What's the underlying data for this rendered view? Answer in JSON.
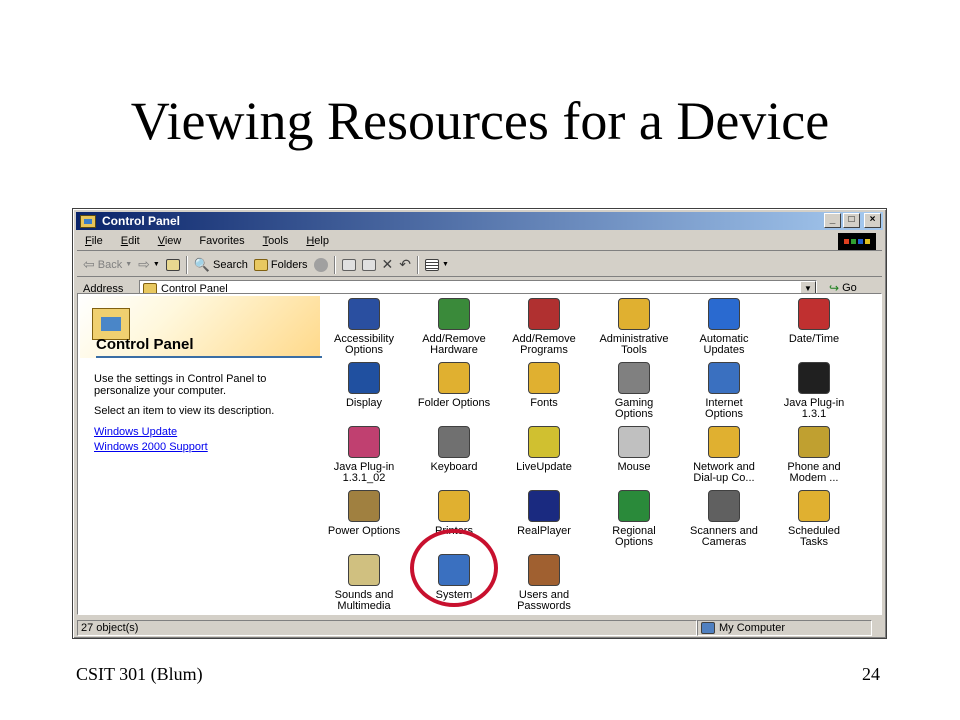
{
  "slide": {
    "title": "Viewing Resources for a Device",
    "footer_left": "CSIT 301 (Blum)",
    "footer_right": "24"
  },
  "window": {
    "title": "Control Panel",
    "buttons": {
      "minimize": "_",
      "maximize": "□",
      "close": "×"
    }
  },
  "menubar": {
    "items": [
      {
        "key": "F",
        "rest": "ile"
      },
      {
        "key": "E",
        "rest": "dit"
      },
      {
        "key": "V",
        "rest": "iew"
      },
      {
        "key": "F",
        "pre": "",
        "label_pre": "",
        "rest": "avorites"
      },
      {
        "key": "T",
        "rest": "ools"
      },
      {
        "key": "H",
        "rest": "elp"
      }
    ]
  },
  "toolbar": {
    "back": "Back",
    "search": "Search",
    "folders": "Folders"
  },
  "address": {
    "label": "Address",
    "value": "Control Panel",
    "go": "Go"
  },
  "leftpane": {
    "heading": "Control Panel",
    "text1": "Use the settings in Control Panel to personalize your computer.",
    "text2": "Select an item to view its description.",
    "link1": "Windows Update",
    "link2": "Windows 2000 Support"
  },
  "icons": [
    {
      "line1": "Accessibility",
      "line2": "Options",
      "icon": "accessibility-icon",
      "color": "#2a4fa0"
    },
    {
      "line1": "Add/Remove",
      "line2": "Hardware",
      "icon": "add-remove-hardware-icon",
      "color": "#3a8a3a"
    },
    {
      "line1": "Add/Remove",
      "line2": "Programs",
      "icon": "add-remove-programs-icon",
      "color": "#b03030"
    },
    {
      "line1": "Administrative",
      "line2": "Tools",
      "icon": "administrative-tools-icon",
      "color": "#e0b030"
    },
    {
      "line1": "Automatic",
      "line2": "Updates",
      "icon": "automatic-updates-icon",
      "color": "#2a6ad0"
    },
    {
      "line1": "Date/Time",
      "line2": "",
      "icon": "date-time-icon",
      "color": "#c03030"
    },
    {
      "line1": "Display",
      "line2": "",
      "icon": "display-icon",
      "color": "#2050a0"
    },
    {
      "line1": "Folder Options",
      "line2": "",
      "icon": "folder-options-icon",
      "color": "#e0b030"
    },
    {
      "line1": "Fonts",
      "line2": "",
      "icon": "fonts-icon",
      "color": "#e0b030"
    },
    {
      "line1": "Gaming",
      "line2": "Options",
      "icon": "gaming-options-icon",
      "color": "#808080"
    },
    {
      "line1": "Internet",
      "line2": "Options",
      "icon": "internet-options-icon",
      "color": "#3a70c0"
    },
    {
      "line1": "Java Plug-in",
      "line2": "1.3.1",
      "icon": "java-plugin-icon",
      "color": "#202020"
    },
    {
      "line1": "Java Plug-in",
      "line2": "1.3.1_02",
      "icon": "java-plugin-icon",
      "color": "#c04070"
    },
    {
      "line1": "Keyboard",
      "line2": "",
      "icon": "keyboard-icon",
      "color": "#707070"
    },
    {
      "line1": "LiveUpdate",
      "line2": "",
      "icon": "liveupdate-icon",
      "color": "#d0c030"
    },
    {
      "line1": "Mouse",
      "line2": "",
      "icon": "mouse-icon",
      "color": "#c0c0c0"
    },
    {
      "line1": "Network and",
      "line2": "Dial-up Co...",
      "icon": "network-icon",
      "color": "#e0b030"
    },
    {
      "line1": "Phone and",
      "line2": "Modem ...",
      "icon": "phone-modem-icon",
      "color": "#c0a030"
    },
    {
      "line1": "Power Options",
      "line2": "",
      "icon": "power-options-icon",
      "color": "#a08040"
    },
    {
      "line1": "Printers",
      "line2": "",
      "icon": "printers-icon",
      "color": "#e0b030"
    },
    {
      "line1": "RealPlayer",
      "line2": "",
      "icon": "realplayer-icon",
      "color": "#1a2a80"
    },
    {
      "line1": "Regional",
      "line2": "Options",
      "icon": "regional-options-icon",
      "color": "#2a8a3a"
    },
    {
      "line1": "Scanners and",
      "line2": "Cameras",
      "icon": "scanners-cameras-icon",
      "color": "#606060"
    },
    {
      "line1": "Scheduled",
      "line2": "Tasks",
      "icon": "scheduled-tasks-icon",
      "color": "#e0b030"
    },
    {
      "line1": "Sounds and",
      "line2": "Multimedia",
      "icon": "sounds-multimedia-icon",
      "color": "#d0c080"
    },
    {
      "line1": "System",
      "line2": "",
      "icon": "system-icon",
      "color": "#3a70c0"
    },
    {
      "line1": "Users and",
      "line2": "Passwords",
      "icon": "users-passwords-icon",
      "color": "#a06030"
    }
  ],
  "status": {
    "count": "27 object(s)",
    "zone": "My Computer"
  },
  "colors": {
    "titlebar_start": "#0a246a",
    "titlebar_end": "#a6caf0",
    "highlight": "#c8102e",
    "link": "#0000ee"
  }
}
